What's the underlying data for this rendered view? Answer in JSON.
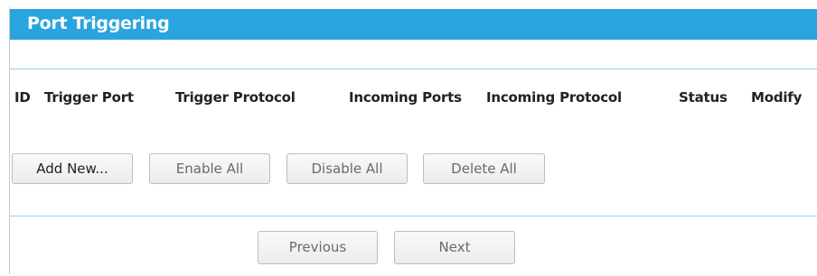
{
  "header": {
    "title": "Port Triggering"
  },
  "table": {
    "columns": [
      "ID",
      "Trigger Port",
      "Trigger Protocol",
      "Incoming Ports",
      "Incoming Protocol",
      "Status",
      "Modify"
    ]
  },
  "actions": {
    "add_new": "Add New...",
    "enable_all": "Enable All",
    "disable_all": "Disable All",
    "delete_all": "Delete All"
  },
  "pagination": {
    "previous": "Previous",
    "next": "Next"
  },
  "colors": {
    "header_bg": "#2aa4df",
    "divider": "#9ccfe6"
  }
}
